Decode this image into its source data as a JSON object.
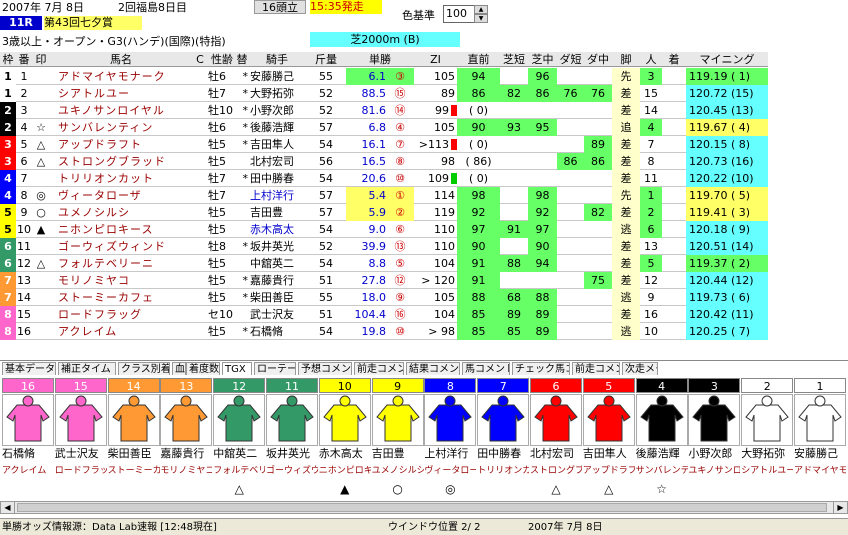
{
  "header": {
    "date": "2007年 7月 8日",
    "meeting": "2回福島8日目",
    "field_count": "16頭立",
    "start_time": "15:35発走",
    "color_base_label": "色基準",
    "color_base_value": "100",
    "race_no": "11R",
    "race_name": "第43回七夕賞",
    "conditions": "3歳以上・オープン・G3(ハンデ)(国際)(特指)",
    "course": "芝2000m (B)"
  },
  "columns": [
    "枠",
    "番",
    "印",
    "馬名",
    "C",
    "性齢",
    "替",
    "騎手",
    "斤量",
    "単勝",
    "ZI",
    "直前",
    "芝短",
    "芝中",
    "ダ短",
    "ダ中",
    "脚",
    "人",
    "着",
    "マイニング"
  ],
  "rows": [
    {
      "waku": "1",
      "ban": "1",
      "mark": "",
      "name": "アドマイヤモナーク",
      "sex": "牡6",
      "kae": "*",
      "jockey": "安藤勝己",
      "kin": "55",
      "odds": "6.1",
      "pop": "③",
      "zi": "105",
      "zimark": "",
      "choku": "94",
      "sst": "",
      "smid": "96",
      "dst": "",
      "dmid": "",
      "ashi": "先",
      "ninki": "3",
      "mining": "119.19 ( 1)"
    },
    {
      "waku": "1",
      "ban": "2",
      "mark": "",
      "name": "シアトルユー",
      "sex": "牡7",
      "kae": "*",
      "jockey": "大野拓弥",
      "kin": "52",
      "odds": "88.5",
      "pop": "⑮",
      "zi": "89",
      "zimark": "",
      "choku": "86",
      "sst": "82",
      "smid": "86",
      "dst": "76",
      "dmid": "76",
      "ashi": "差",
      "ninki": "15",
      "mining": "120.72 (15)"
    },
    {
      "waku": "2",
      "ban": "3",
      "mark": "",
      "name": "ユキノサンロイヤル",
      "sex": "牡10",
      "kae": "*",
      "jockey": "小野次郎",
      "kin": "52",
      "odds": "81.6",
      "pop": "⑭",
      "zi": "99",
      "zimark": "red",
      "choku": "( 0)",
      "sst": "",
      "smid": "",
      "dst": "",
      "dmid": "",
      "ashi": "差",
      "ninki": "14",
      "mining": "120.45 (13)"
    },
    {
      "waku": "2",
      "ban": "4",
      "mark": "☆",
      "name": "サンバレンティン",
      "sex": "牡6",
      "kae": "*",
      "jockey": "後藤浩輝",
      "kin": "57",
      "odds": "6.8",
      "pop": "④",
      "zi": "105",
      "zimark": "",
      "choku": "90",
      "sst": "93",
      "smid": "95",
      "dst": "",
      "dmid": "",
      "ashi": "追",
      "ninki": "4",
      "mining": "119.67 ( 4)"
    },
    {
      "waku": "3",
      "ban": "5",
      "mark": "△",
      "name": "アップドラフト",
      "sex": "牡5",
      "kae": "*",
      "jockey": "吉田隼人",
      "kin": "54",
      "odds": "16.1",
      "pop": "⑦",
      "zi": ">113",
      "zimark": "red",
      "choku": "( 0)",
      "sst": "",
      "smid": "",
      "dst": "",
      "dmid": "89",
      "ashi": "差",
      "ninki": "7",
      "mining": "120.15 ( 8)"
    },
    {
      "waku": "3",
      "ban": "6",
      "mark": "△",
      "name": "ストロングブラッド",
      "sex": "牡5",
      "kae": "",
      "jockey": "北村宏司",
      "kin": "56",
      "odds": "16.5",
      "pop": "⑧",
      "zi": "98",
      "zimark": "",
      "choku": "( 86)",
      "sst": "",
      "smid": "",
      "dst": "86",
      "dmid": "86",
      "ashi": "差",
      "ninki": "8",
      "mining": "120.73 (16)"
    },
    {
      "waku": "4",
      "ban": "7",
      "mark": "",
      "name": "トリリオンカット",
      "sex": "牡7",
      "kae": "*",
      "jockey": "田中勝春",
      "kin": "54",
      "odds": "20.6",
      "pop": "⑩",
      "zi": "109",
      "zimark": "green",
      "choku": "( 0)",
      "sst": "",
      "smid": "",
      "dst": "",
      "dmid": "",
      "ashi": "差",
      "ninki": "11",
      "mining": "120.22 (10)"
    },
    {
      "waku": "4",
      "ban": "8",
      "mark": "◎",
      "name": "ヴィータローザ",
      "sex": "牡7",
      "kae": "",
      "jockey": "上村洋行",
      "kin": "57",
      "odds": "5.4",
      "pop": "①",
      "zi": "114",
      "zimark": "",
      "choku": "98",
      "sst": "",
      "smid": "98",
      "dst": "",
      "dmid": "",
      "ashi": "先",
      "ninki": "1",
      "mining": "119.70 ( 5)"
    },
    {
      "waku": "5",
      "ban": "9",
      "mark": "○",
      "name": "ユメノシルシ",
      "sex": "牡5",
      "kae": "",
      "jockey": "吉田豊",
      "kin": "57",
      "odds": "5.9",
      "pop": "②",
      "zi": "119",
      "zimark": "",
      "choku": "92",
      "sst": "",
      "smid": "92",
      "dst": "",
      "dmid": "82",
      "ashi": "差",
      "ninki": "2",
      "mining": "119.41 ( 3)"
    },
    {
      "waku": "5",
      "ban": "10",
      "mark": "▲",
      "name": "ニホンピロキース",
      "sex": "牡5",
      "kae": "",
      "jockey": "赤木高太",
      "kin": "54",
      "odds": "9.0",
      "pop": "⑥",
      "zi": "110",
      "zimark": "",
      "choku": "97",
      "sst": "91",
      "smid": "97",
      "dst": "",
      "dmid": "",
      "ashi": "逃",
      "ninki": "6",
      "mining": "120.18 ( 9)"
    },
    {
      "waku": "6",
      "ban": "11",
      "mark": "",
      "name": "ゴーウィズウィンド",
      "sex": "牡8",
      "kae": "*",
      "jockey": "坂井英光",
      "kin": "52",
      "odds": "39.9",
      "pop": "⑬",
      "zi": "110",
      "zimark": "",
      "choku": "90",
      "sst": "",
      "smid": "90",
      "dst": "",
      "dmid": "",
      "ashi": "差",
      "ninki": "13",
      "mining": "120.51 (14)"
    },
    {
      "waku": "6",
      "ban": "12",
      "mark": "△",
      "name": "フォルテベリーニ",
      "sex": "牡5",
      "kae": "",
      "jockey": "中舘英二",
      "kin": "54",
      "odds": "8.8",
      "pop": "⑤",
      "zi": "104",
      "zimark": "",
      "choku": "91",
      "sst": "88",
      "smid": "94",
      "dst": "",
      "dmid": "",
      "ashi": "差",
      "ninki": "5",
      "mining": "119.37 ( 2)"
    },
    {
      "waku": "7",
      "ban": "13",
      "mark": "",
      "name": "モリノミヤコ",
      "sex": "牡5",
      "kae": "*",
      "jockey": "嘉藤貴行",
      "kin": "51",
      "odds": "27.8",
      "pop": "⑫",
      "zi": "> 120",
      "zimark": "",
      "choku": "91",
      "sst": "",
      "smid": "",
      "dst": "",
      "dmid": "75",
      "ashi": "差",
      "ninki": "12",
      "mining": "120.44 (12)"
    },
    {
      "waku": "7",
      "ban": "14",
      "mark": "",
      "name": "ストーミーカフェ",
      "sex": "牡5",
      "kae": "*",
      "jockey": "柴田善臣",
      "kin": "55",
      "odds": "18.0",
      "pop": "⑨",
      "zi": "105",
      "zimark": "",
      "choku": "88",
      "sst": "68",
      "smid": "88",
      "dst": "",
      "dmid": "",
      "ashi": "逃",
      "ninki": "9",
      "mining": "119.73 ( 6)"
    },
    {
      "waku": "8",
      "ban": "15",
      "mark": "",
      "name": "ロードフラッグ",
      "sex": "セ10",
      "kae": "",
      "jockey": "武士沢友",
      "kin": "51",
      "odds": "104.4",
      "pop": "⑯",
      "zi": "104",
      "zimark": "",
      "choku": "85",
      "sst": "89",
      "smid": "89",
      "dst": "",
      "dmid": "",
      "ashi": "差",
      "ninki": "16",
      "mining": "120.42 (11)"
    },
    {
      "waku": "8",
      "ban": "16",
      "mark": "",
      "name": "アクレイム",
      "sex": "牡5",
      "kae": "*",
      "jockey": "石橋脩",
      "kin": "54",
      "odds": "19.8",
      "pop": "⑩",
      "zi": "> 98",
      "zimark": "",
      "choku": "85",
      "sst": "85",
      "smid": "89",
      "dst": "",
      "dmid": "",
      "ashi": "逃",
      "ninki": "10",
      "mining": "120.25 ( 7)"
    }
  ],
  "tabs": [
    "基本データ",
    "補正タイム",
    "クラス別着順",
    "血統",
    "着度数",
    "TGX",
    "ローテーション",
    "予想コメント",
    "前走コメント",
    "結果コメント",
    "馬コメント",
    "チェック馬コメント",
    "前走コメント",
    "次走メモ"
  ],
  "silks": [
    {
      "num": "16",
      "jockey": "石橋脩",
      "horse": "アクレイム",
      "mark": "",
      "color": "#ff66cc"
    },
    {
      "num": "15",
      "jockey": "武士沢友",
      "horse": "ロードフラッグ",
      "mark": "",
      "color": "#ff66cc"
    },
    {
      "num": "14",
      "jockey": "柴田善臣",
      "horse": "ストーミーカフェ",
      "mark": "",
      "color": "#ff9933"
    },
    {
      "num": "13",
      "jockey": "嘉藤貴行",
      "horse": "モリノミヤコ",
      "mark": "",
      "color": "#ff9933"
    },
    {
      "num": "12",
      "jockey": "中舘英二",
      "horse": "フォルテベリーニ",
      "mark": "△",
      "color": "#339966"
    },
    {
      "num": "11",
      "jockey": "坂井英光",
      "horse": "ゴーウィズウィンド",
      "mark": "",
      "color": "#339966"
    },
    {
      "num": "10",
      "jockey": "赤木高太",
      "horse": "ニホンピロキース",
      "mark": "▲",
      "color": "#ffff00"
    },
    {
      "num": "9",
      "jockey": "吉田豊",
      "horse": "ユメノシルシ",
      "mark": "○",
      "color": "#ffff00"
    },
    {
      "num": "8",
      "jockey": "上村洋行",
      "horse": "ヴィータローザ",
      "mark": "◎",
      "color": "#0000ff"
    },
    {
      "num": "7",
      "jockey": "田中勝春",
      "horse": "トリリオンカット",
      "mark": "",
      "color": "#0000ff"
    },
    {
      "num": "6",
      "jockey": "北村宏司",
      "horse": "ストロングブラッド",
      "mark": "△",
      "color": "#ff0000"
    },
    {
      "num": "5",
      "jockey": "吉田隼人",
      "horse": "アップドラフト",
      "mark": "△",
      "color": "#ff0000"
    },
    {
      "num": "4",
      "jockey": "後藤浩輝",
      "horse": "サンバレンティン",
      "mark": "☆",
      "color": "#000000"
    },
    {
      "num": "3",
      "jockey": "小野次郎",
      "horse": "ユキノサンロイヤル",
      "mark": "",
      "color": "#000000"
    },
    {
      "num": "2",
      "jockey": "大野拓弥",
      "horse": "シアトルユー",
      "mark": "",
      "color": "#ffffff"
    },
    {
      "num": "1",
      "jockey": "安藤勝己",
      "horse": "アドマイヤモナーク",
      "mark": "",
      "color": "#ffffff"
    }
  ],
  "status": {
    "odds_info": "単勝オッズ情報源：Data Lab速報 [12:48現在]",
    "window_pos": "ウインドウ位置 2/ 2",
    "date": "2007年 7月 8日"
  },
  "colors": {
    "waku": {
      "1": "#ffffff",
      "2": "#000000",
      "3": "#ff0000",
      "4": "#0000ff",
      "5": "#ffff00",
      "6": "#339966",
      "7": "#ff9933",
      "8": "#ff66cc"
    },
    "green_cell": "#66ff66",
    "cyan_cell": "#66ffff",
    "yellow_cell": "#ffff66"
  }
}
